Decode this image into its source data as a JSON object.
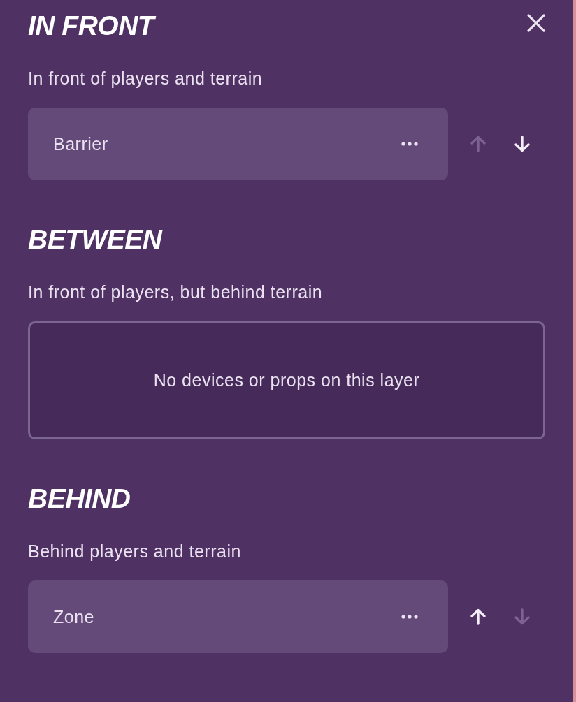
{
  "layers": [
    {
      "title": "IN FRONT",
      "description": "In front of players and terrain",
      "items": [
        {
          "name": "Barrier",
          "up_disabled": true,
          "down_disabled": false
        }
      ]
    },
    {
      "title": "BETWEEN",
      "description": "In front of players, but behind terrain",
      "empty_message": "No devices or props on this layer"
    },
    {
      "title": "BEHIND",
      "description": "Behind players and terrain",
      "items": [
        {
          "name": "Zone",
          "up_disabled": false,
          "down_disabled": true
        }
      ]
    }
  ]
}
